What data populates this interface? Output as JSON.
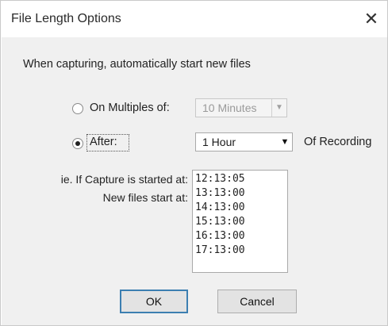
{
  "window": {
    "title": "File Length Options",
    "close_glyph": "✕"
  },
  "intro_text": "When capturing, automatically start new files",
  "option_multiples": {
    "label": "On Multiples of:",
    "selected": false,
    "combo_value": "10 Minutes",
    "enabled": false
  },
  "option_after": {
    "label": "After:",
    "selected": true,
    "combo_value": "1 Hour",
    "suffix": "Of Recording"
  },
  "example": {
    "started_label": "ie. If Capture is started at:",
    "new_files_label": "New files start at:",
    "times": [
      "12:13:05",
      "13:13:00",
      "14:13:00",
      "15:13:00",
      "16:13:00",
      "17:13:00"
    ]
  },
  "buttons": {
    "ok": "OK",
    "cancel": "Cancel"
  },
  "icons": {
    "combo_arrow": "▼"
  }
}
